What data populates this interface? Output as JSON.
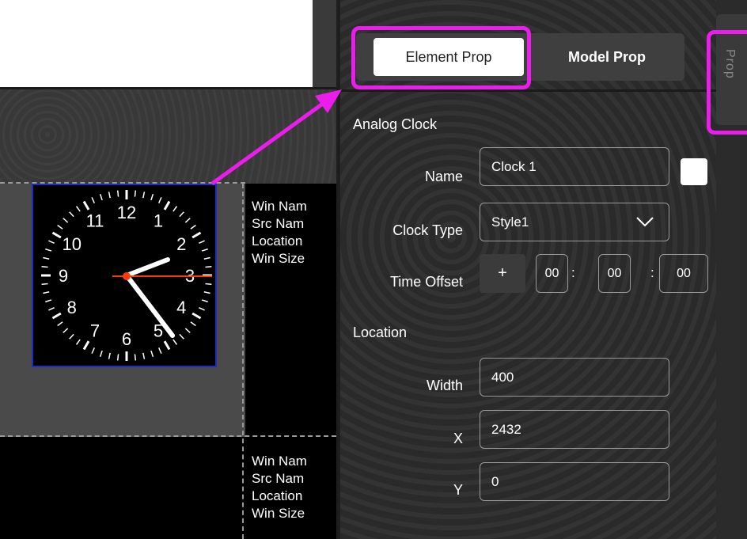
{
  "tabs": {
    "element_prop": "Element Prop",
    "model_prop": "Model Prop"
  },
  "side_tab": {
    "label": "Prop"
  },
  "clock_section": {
    "title": "Analog Clock",
    "name_label": "Name",
    "name_value": "Clock 1",
    "clock_type_label": "Clock Type",
    "clock_type_value": "Style1",
    "time_offset_label": "Time Offset",
    "time_offset_sign": "+",
    "time_offset": {
      "hours": "00",
      "minutes": "00",
      "seconds": "00"
    },
    "color_value": "#ffffff"
  },
  "location_section": {
    "title": "Location",
    "width_label": "Width",
    "width_value": "400",
    "x_label": "X",
    "x_value": "2432",
    "y_label": "Y",
    "y_value": "0"
  },
  "window_info_1": {
    "win_name": "Win Nam",
    "src_name": "Src Nam",
    "location": "Location",
    "win_size": "Win Size"
  },
  "window_info_2": {
    "win_name": "Win Nam",
    "src_name": "Src Nam",
    "location": "Location",
    "win_size": "Win Size"
  },
  "clock_preview": {
    "numbers": [
      "12",
      "1",
      "2",
      "3",
      "4",
      "5",
      "6",
      "7",
      "8",
      "9",
      "10",
      "11"
    ]
  },
  "colors": {
    "highlight": "#ea1dea",
    "clock_border": "#1f2cc4",
    "second_hand": "#ff3b0a"
  }
}
